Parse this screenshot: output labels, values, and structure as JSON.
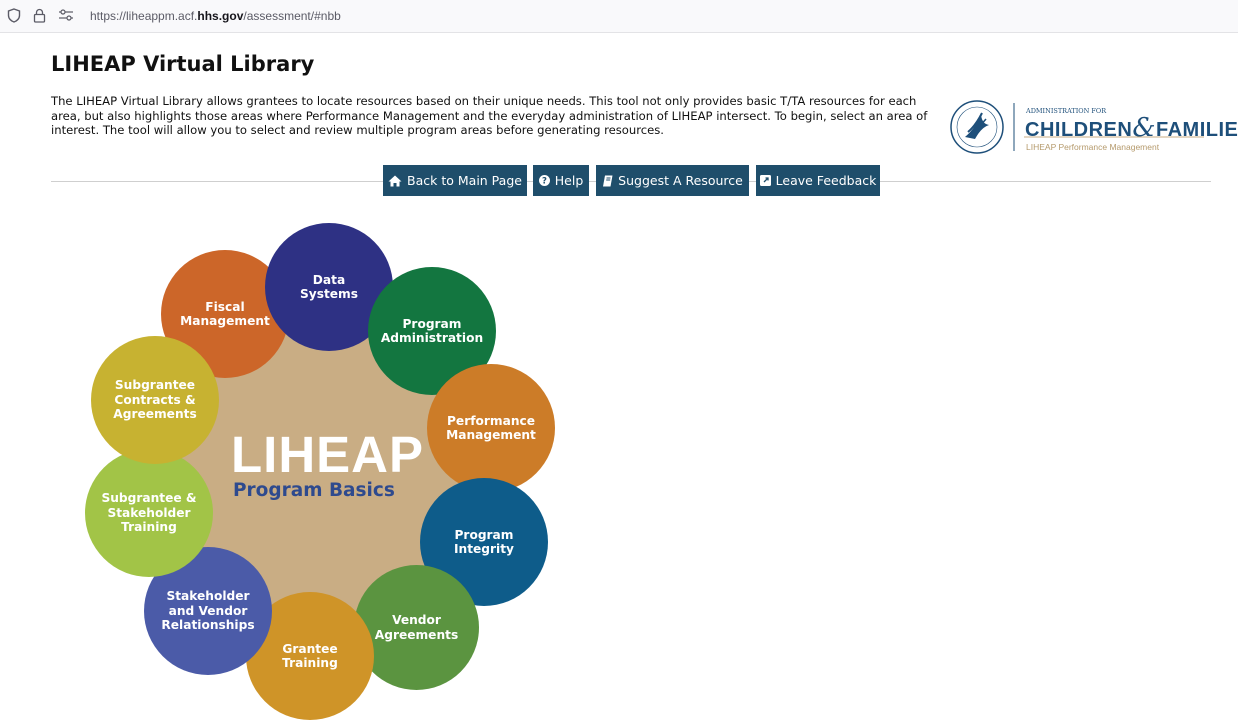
{
  "browser": {
    "url_prefix": "https://liheappm.acf.",
    "url_host": "hhs.gov",
    "url_path": "/assessment/#nbb",
    "icons": [
      "shield-icon",
      "lock-icon",
      "permissions-icon"
    ]
  },
  "page": {
    "title": "LIHEAP Virtual Library",
    "intro": "The LIHEAP Virtual Library allows grantees to locate resources based on their unique needs. This tool not only provides basic T/TA resources for each area, but also highlights those areas where Performance Management and the everyday administration of LIHEAP intersect. To begin, select an area of interest. The tool will allow you to select and review multiple program areas before generating resources."
  },
  "logo": {
    "line1": "ADMINISTRATION FOR",
    "line2a": "CHILDREN",
    "amp": "&",
    "line2b": "FAMILIES",
    "tagline": "LIHEAP Performance Management",
    "seal_text": "DEPARTMENT OF HEALTH & HUMAN SERVICES USA"
  },
  "nav": {
    "back": "Back to Main Page",
    "help": "Help",
    "suggest": "Suggest A Resource",
    "feedback": "Leave Feedback"
  },
  "wheel": {
    "center_title": "LIHEAP",
    "center_subtitle": "Program Basics",
    "center_color": "#c9ad84",
    "areas": [
      {
        "label": "Data Systems",
        "color": "#2e3184"
      },
      {
        "label": "Program Administration",
        "color": "#137640"
      },
      {
        "label": "Performance Management",
        "color": "#cc7c28"
      },
      {
        "label": "Program Integrity",
        "color": "#0e5c8a"
      },
      {
        "label": "Vendor Agreements",
        "color": "#5b9440"
      },
      {
        "label": "Grantee Training",
        "color": "#cf9428"
      },
      {
        "label": "Stakeholder and Vendor Relationships",
        "color": "#4b5ba8"
      },
      {
        "label": "Subgrantee & Stakeholder Training",
        "color": "#a2c447"
      },
      {
        "label": "Subgrantee Contracts & Agreements",
        "color": "#c7b231"
      },
      {
        "label": "Fiscal Management",
        "color": "#cc6629"
      }
    ]
  }
}
